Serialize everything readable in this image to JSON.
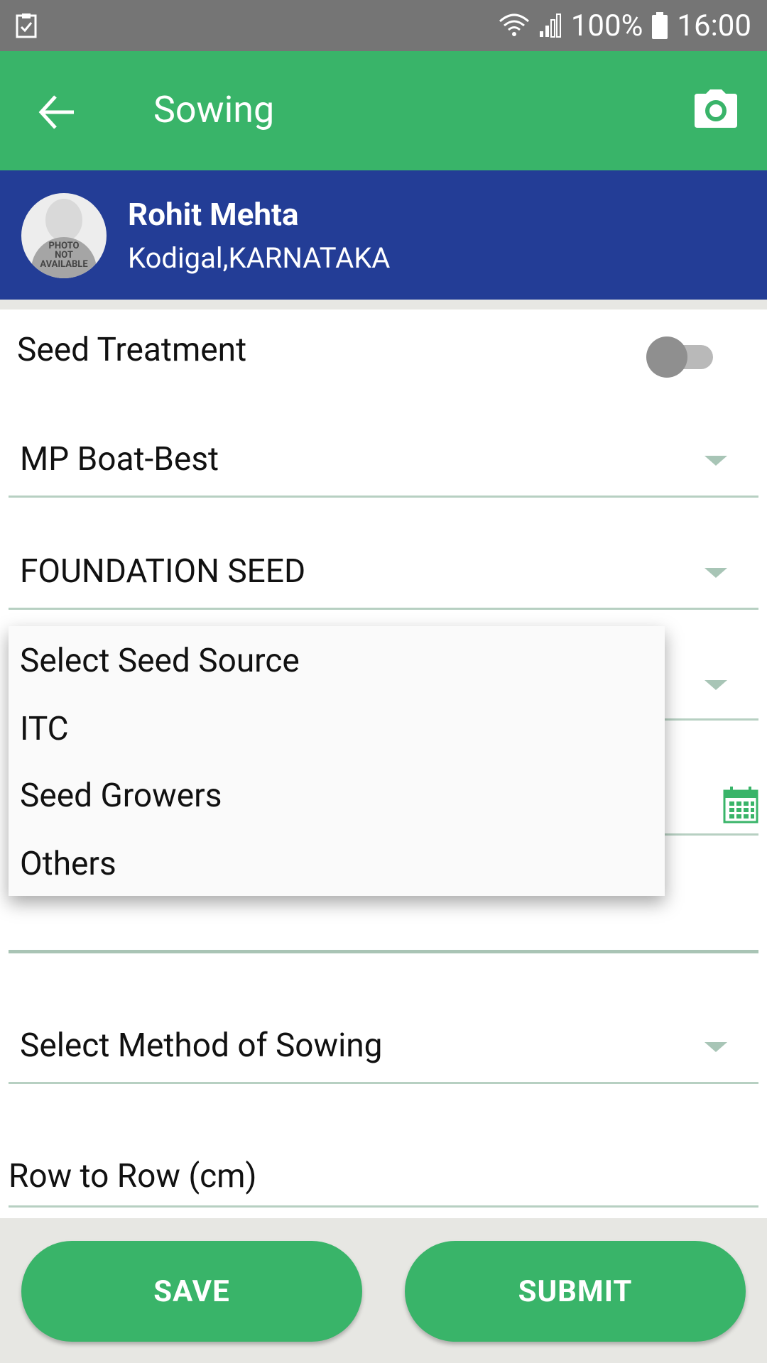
{
  "status_bar": {
    "battery": "100%",
    "time": "16:00",
    "icons": [
      "clipboard-check-icon",
      "wifi-icon",
      "signal-icon",
      "battery-icon"
    ]
  },
  "app_bar": {
    "title": "Sowing",
    "icons": [
      "back-arrow-icon",
      "camera-icon"
    ]
  },
  "profile": {
    "name": "Rohit Mehta",
    "location": "Kodigal,KARNATAKA",
    "avatar_text": [
      "PHOTO",
      "NOT",
      "AVAILABLE"
    ]
  },
  "form": {
    "seed_treatment_label": "Seed Treatment",
    "seed_treatment_on": false,
    "variety_value": "MP Boat-Best",
    "seed_class_value": "FOUNDATION SEED",
    "method_of_sowing_value": "Select Method of Sowing",
    "row_to_row_label": "Row to Row (cm)"
  },
  "seed_source_dropdown": {
    "options": [
      "Select Seed Source",
      "ITC",
      "Seed Growers",
      "Others"
    ]
  },
  "actions": {
    "save_label": "SAVE",
    "submit_label": "SUBMIT"
  },
  "colors": {
    "primary_green": "#39b469",
    "header_blue": "#233d96",
    "status_gray": "#757575"
  }
}
